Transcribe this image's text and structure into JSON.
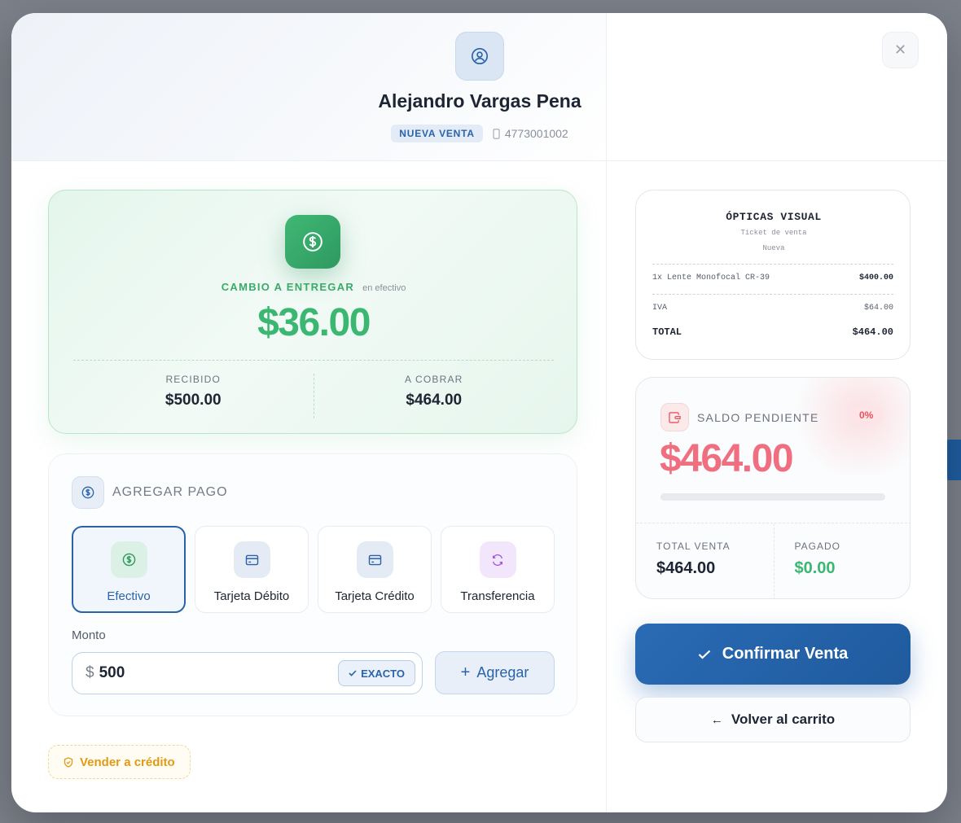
{
  "customer": {
    "name": "Alejandro Vargas Pena",
    "badge": "NUEVA VENTA",
    "phone": "4773001002"
  },
  "change": {
    "label": "CAMBIO A ENTREGAR",
    "sublabel": "en efectivo",
    "amount": "$36.00",
    "received_label": "RECIBIDO",
    "received_value": "$500.00",
    "to_charge_label": "A COBRAR",
    "to_charge_value": "$464.00"
  },
  "payment": {
    "title": "AGREGAR PAGO",
    "methods": [
      {
        "label": "Efectivo",
        "icon": "cash-icon",
        "active": true
      },
      {
        "label": "Tarjeta Débito",
        "icon": "card-icon",
        "active": false
      },
      {
        "label": "Tarjeta Crédito",
        "icon": "card-icon",
        "active": false
      },
      {
        "label": "Transferencia",
        "icon": "transfer-icon",
        "active": false
      }
    ],
    "amount_label": "Monto",
    "currency": "$",
    "amount_value": "500",
    "exact_label": "EXACTO",
    "add_label": "Agregar"
  },
  "credit": {
    "label": "Vender a crédito"
  },
  "ticket": {
    "store": "ÓPTICAS VISUAL",
    "subtitle": "Ticket de venta",
    "status": "Nueva",
    "items": [
      {
        "desc": "1x Lente Monofocal CR-39",
        "amount": "$400.00"
      }
    ],
    "tax_label": "IVA",
    "tax_value": "$64.00",
    "total_label": "TOTAL",
    "total_value": "$464.00"
  },
  "balance": {
    "title": "SALDO PENDIENTE",
    "percent": "0%",
    "percent_value": 0,
    "amount": "$464.00",
    "total_label": "TOTAL VENTA",
    "total_value": "$464.00",
    "paid_label": "PAGADO",
    "paid_value": "$0.00"
  },
  "actions": {
    "confirm": "Confirmar Venta",
    "back": "Volver al carrito"
  },
  "colors": {
    "primary": "#2a63a8",
    "success": "#3bb772",
    "danger": "#ef6f80",
    "warning": "#e29a14"
  }
}
